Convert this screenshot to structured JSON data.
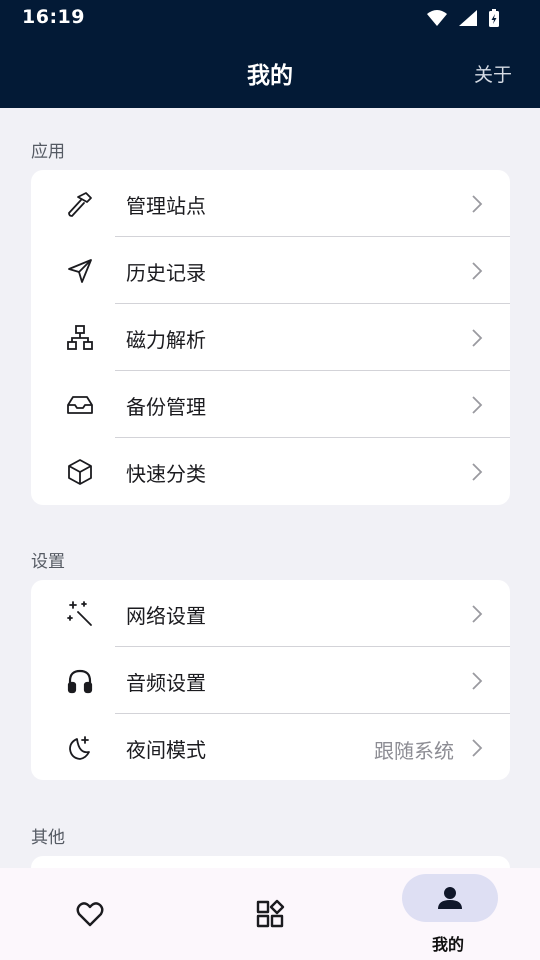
{
  "status": {
    "time": "16:19"
  },
  "header": {
    "title": "我的",
    "action_label": "关于"
  },
  "sections": [
    {
      "title": "应用",
      "items": [
        {
          "label": "管理站点",
          "icon": "hammer-icon"
        },
        {
          "label": "历史记录",
          "icon": "send-icon"
        },
        {
          "label": "磁力解析",
          "icon": "sitemap-icon"
        },
        {
          "label": "备份管理",
          "icon": "inbox-icon"
        },
        {
          "label": "快速分类",
          "icon": "cube-icon"
        }
      ]
    },
    {
      "title": "设置",
      "items": [
        {
          "label": "网络设置",
          "icon": "magic-wand-icon"
        },
        {
          "label": "音频设置",
          "icon": "headphones-icon"
        },
        {
          "label": "夜间模式",
          "icon": "moon-stars-icon",
          "value": "跟随系统"
        }
      ]
    },
    {
      "title": "其他",
      "items": []
    }
  ],
  "bottom_nav": {
    "items": [
      {
        "icon": "heart-icon",
        "label": ""
      },
      {
        "icon": "grid-icon",
        "label": ""
      },
      {
        "icon": "person-icon",
        "label": "我的",
        "active": true
      }
    ]
  },
  "colors": {
    "header_bg": "#031a36",
    "page_bg": "#f1f1f6",
    "nav_bg": "#fcf7fc",
    "active_pill": "#dedff3"
  }
}
